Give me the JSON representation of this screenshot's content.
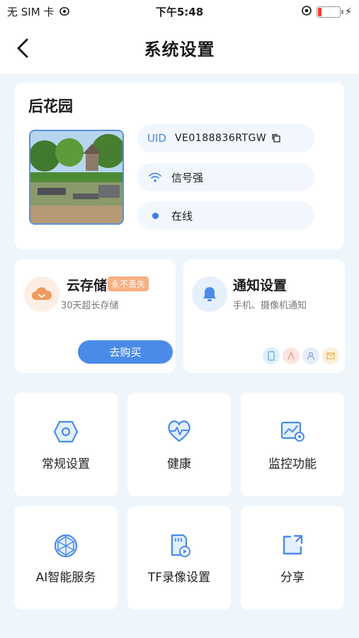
{
  "status_bar": {
    "carrier": "无 SIM 卡",
    "time": "下午5:48"
  },
  "header": {
    "title": "系统设置"
  },
  "device": {
    "name": "后花园",
    "uid_label": "UID",
    "uid_value": "VE0188836RTGW",
    "signal_text": "信号强",
    "status_text": "在线"
  },
  "cloud_storage": {
    "title": "云存储",
    "badge": "永不丢失",
    "subtitle": "30天超长存储",
    "button_label": "去购买"
  },
  "notification": {
    "title": "通知设置",
    "subtitle": "手机、摄像机通知"
  },
  "menu": {
    "items": [
      {
        "label": "常规设置",
        "icon": "hexagon-settings-icon"
      },
      {
        "label": "健康",
        "icon": "heart-pulse-icon"
      },
      {
        "label": "监控功能",
        "icon": "monitor-chart-icon"
      },
      {
        "label": "AI智能服务",
        "icon": "ai-globe-icon"
      },
      {
        "label": "TF录像设置",
        "icon": "sd-card-icon"
      },
      {
        "label": "分享",
        "icon": "share-icon"
      }
    ]
  },
  "colors": {
    "accent": "#4b8be8",
    "background": "#eef6fb",
    "badge": "#f7b082",
    "cloud_icon": "#f19a5c",
    "battery_low": "#ff3b30"
  }
}
